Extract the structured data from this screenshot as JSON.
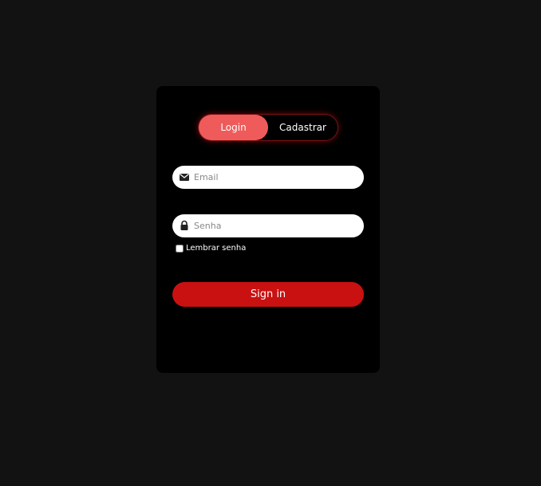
{
  "tabs": {
    "login": "Login",
    "register": "Cadastrar"
  },
  "form": {
    "email": {
      "placeholder": "Email",
      "value": "",
      "icon": "envelope-icon"
    },
    "password": {
      "placeholder": "Senha",
      "value": "",
      "icon": "lock-icon"
    },
    "remember_label": "Lembrar senha",
    "remember_checked": false,
    "submit_label": "Sign in"
  },
  "colors": {
    "page_bg": "#121212",
    "card_bg": "#000000",
    "active_tab": "#ef5b5b",
    "button": "#c91111"
  }
}
